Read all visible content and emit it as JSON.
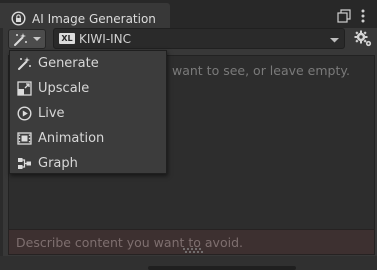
{
  "window": {
    "title": "AI Image Generation"
  },
  "toolbar": {
    "mode_icon": "magic-wand-icon"
  },
  "model": {
    "badge": "XL",
    "name": "KIWI-INC"
  },
  "prompt": {
    "placeholder_visible": "want to see, or leave empty."
  },
  "negative_prompt": {
    "placeholder": "Describe content you want to avoid."
  },
  "menu": {
    "items": [
      {
        "label": "Generate",
        "icon": "magic-wand-icon"
      },
      {
        "label": "Upscale",
        "icon": "upscale-icon"
      },
      {
        "label": "Live",
        "icon": "play-icon"
      },
      {
        "label": "Animation",
        "icon": "film-icon"
      },
      {
        "label": "Graph",
        "icon": "graph-icon"
      }
    ]
  },
  "colors": {
    "background": "#383838",
    "titlebar": "#282828",
    "input": "#2d2d2d",
    "negative_input": "#3d3030",
    "text": "#d2d2d2",
    "placeholder": "#7a7a7a"
  }
}
